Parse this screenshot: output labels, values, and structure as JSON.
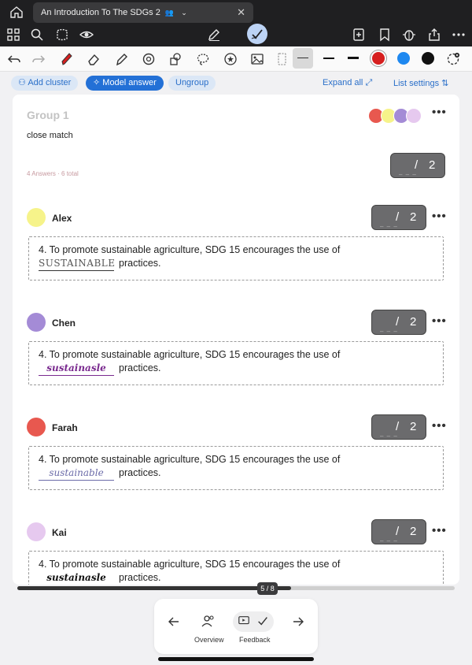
{
  "tab": {
    "title": "An Introduction To The SDGs 2",
    "share_icon": "people-icon",
    "close": "✕"
  },
  "toolbar": {
    "icons": [
      "grid-icon",
      "search-icon",
      "lasso-icon",
      "eye-icon",
      "pen-icon",
      "check-icon",
      "add-page-icon",
      "bookmark-icon",
      "bug-icon",
      "share-icon",
      "more-icon"
    ]
  },
  "actions": {
    "add_cluster": "Add cluster",
    "model_answer": "Model answer",
    "ungroup": "Ungroup",
    "expand_all": "Expand all",
    "list_settings": "List settings"
  },
  "group": {
    "title": "Group 1",
    "note": "close match",
    "count": "4 Answers · 6 total",
    "score": {
      "points": "",
      "slash": "/",
      "total": "2"
    }
  },
  "answers": [
    {
      "name": "Alex",
      "avatar_color": "#f6f38a",
      "prompt": "4. To promote sustainable agriculture, SDG 15 encourages the use of",
      "handwritten": "SUSTAINABLE",
      "ink": "#555555",
      "suffix": "practices.",
      "score": {
        "slash": "/",
        "total": "2"
      }
    },
    {
      "name": "Chen",
      "avatar_color": "#a48bd6",
      "prompt": "4. To promote sustainable agriculture, SDG 15 encourages the use of",
      "handwritten": "sustainasle",
      "ink": "#7a2a8f",
      "suffix": "practices.",
      "score": {
        "slash": "/",
        "total": "2"
      }
    },
    {
      "name": "Farah",
      "avatar_color": "#e8584f",
      "prompt": "4. To promote sustainable agriculture, SDG 15 encourages the use of",
      "handwritten": "sustainable",
      "ink": "#6a6aa8",
      "suffix": "practices.",
      "score": {
        "slash": "/",
        "total": "2"
      }
    },
    {
      "name": "Kai",
      "avatar_color": "#e6c9ef",
      "prompt": "4. To promote sustainable agriculture, SDG 15 encourages the use of",
      "handwritten": "sustainasle",
      "ink": "#111111",
      "suffix": "practices.",
      "score": {
        "slash": "/",
        "total": "2"
      }
    }
  ],
  "pager": {
    "label": "5 / 8",
    "current": 5,
    "total": 8
  },
  "bottom_nav": {
    "overview": "Overview",
    "feedback": "Feedback"
  },
  "colors": {
    "accent": "#2370d6",
    "red": "#d61f1f",
    "blue": "#1e88f0",
    "black": "#111111"
  }
}
